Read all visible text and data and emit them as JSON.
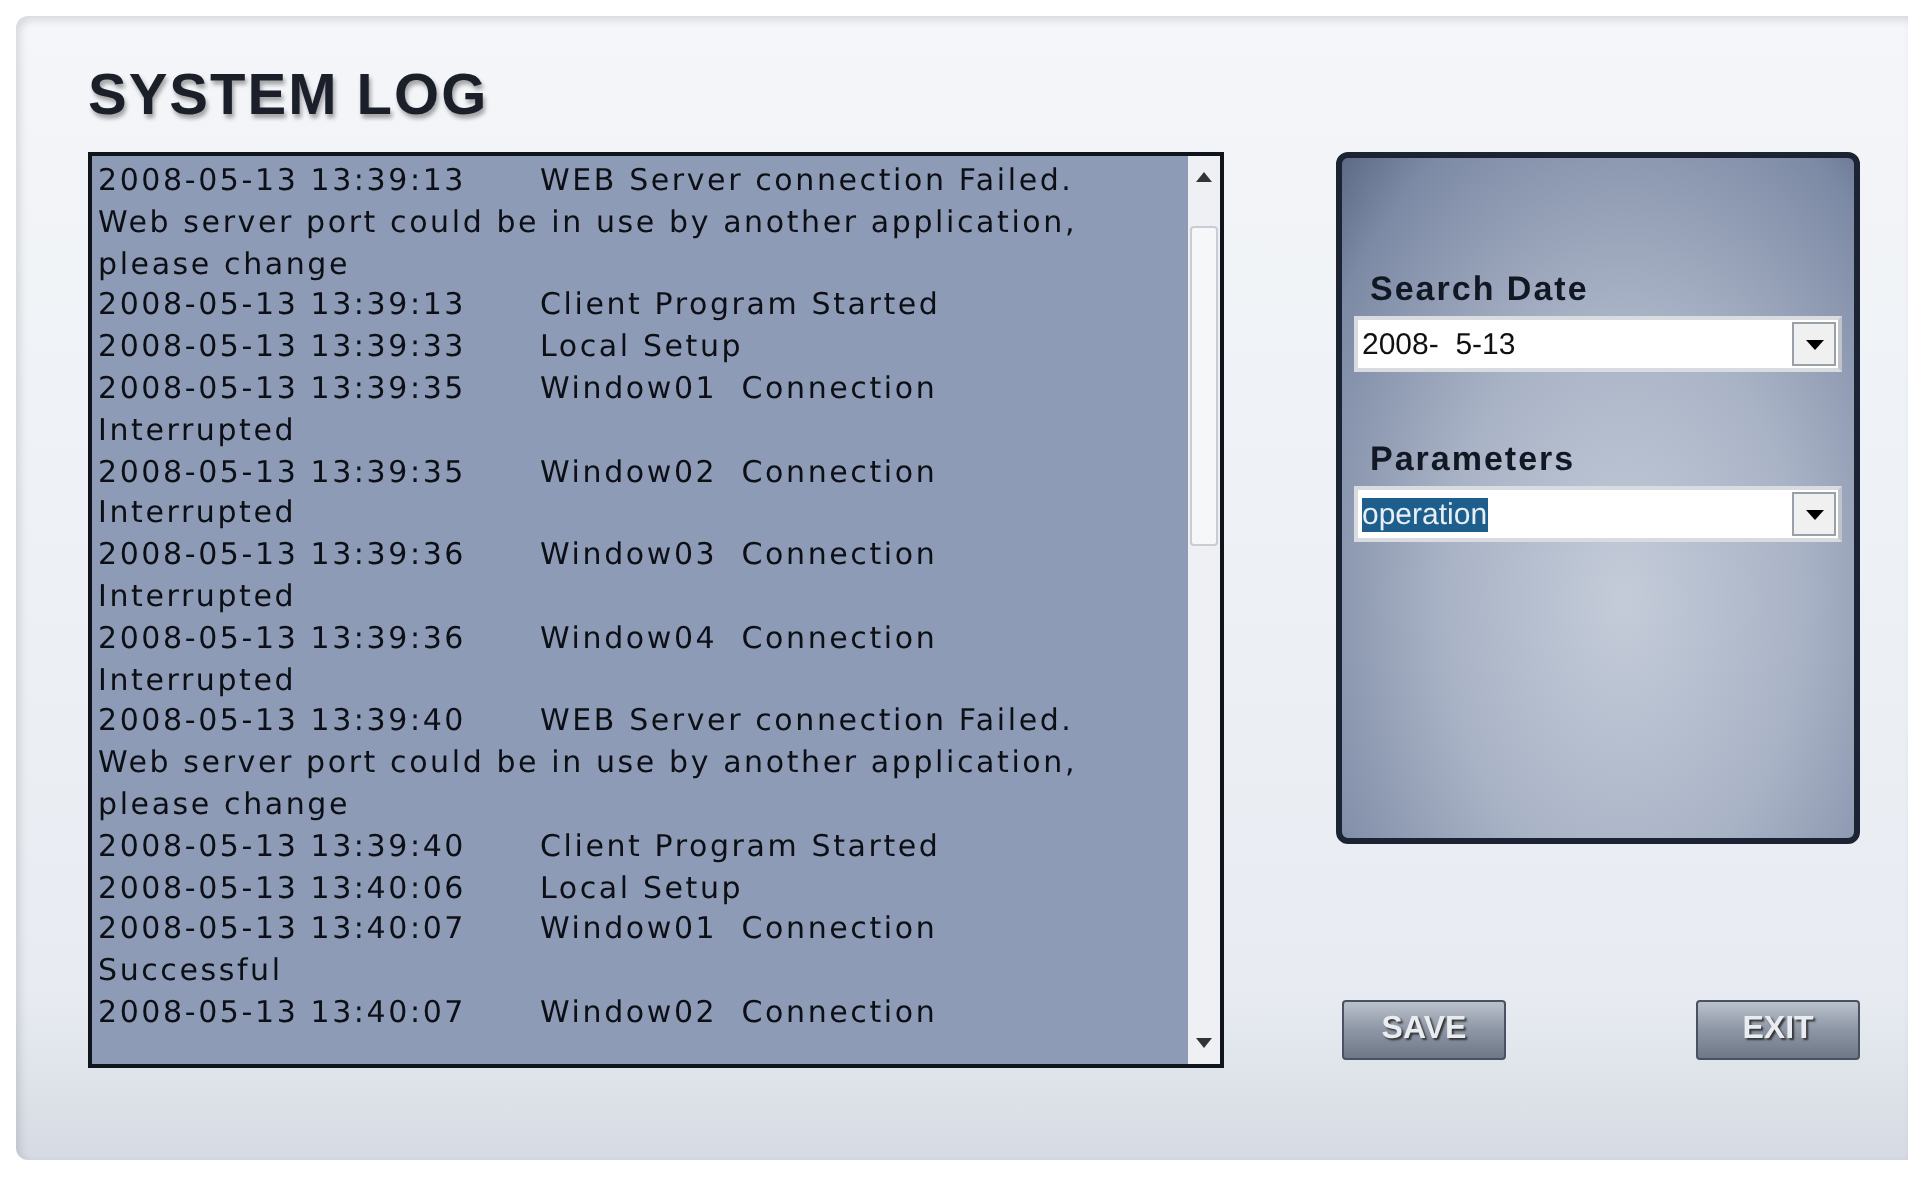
{
  "title": "SYSTEM LOG",
  "log": [
    {
      "time": "2008-05-13 13:39:13",
      "message": "WEB Server connection Failed.",
      "continued": [
        "Web server port could be in use by another application,",
        "please change"
      ]
    },
    {
      "time": "2008-05-13 13:39:13",
      "message": "Client Program Started"
    },
    {
      "time": "2008-05-13 13:39:33",
      "message": "Local Setup"
    },
    {
      "time": "2008-05-13 13:39:35",
      "message": "Window01  Connection",
      "continued": [
        "Interrupted"
      ]
    },
    {
      "time": "2008-05-13 13:39:35",
      "message": "Window02  Connection",
      "continued": [
        "Interrupted"
      ]
    },
    {
      "time": "2008-05-13 13:39:36",
      "message": "Window03  Connection",
      "continued": [
        "Interrupted"
      ]
    },
    {
      "time": "2008-05-13 13:39:36",
      "message": "Window04  Connection",
      "continued": [
        "Interrupted"
      ]
    },
    {
      "time": "2008-05-13 13:39:40",
      "message": "WEB Server connection Failed.",
      "continued": [
        "Web server port could be in use by another application,",
        "please change"
      ]
    },
    {
      "time": "2008-05-13 13:39:40",
      "message": "Client Program Started"
    },
    {
      "time": "2008-05-13 13:40:06",
      "message": "Local Setup"
    },
    {
      "time": "2008-05-13 13:40:07",
      "message": "Window01  Connection",
      "continued": [
        "Successful"
      ]
    },
    {
      "time": "2008-05-13 13:40:07",
      "message": "Window02  Connection"
    }
  ],
  "filters": [
    {
      "label": "Search Date",
      "value": "2008-  5-13",
      "highlighted": false
    },
    {
      "label": "Parameters",
      "value": "operation",
      "highlighted": true
    }
  ],
  "buttons": [
    "SAVE",
    "EXIT"
  ]
}
